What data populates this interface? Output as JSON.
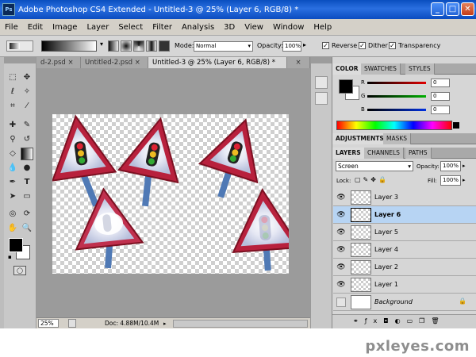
{
  "window": {
    "title": "Adobe Photoshop CS4 Extended - Untitled-3 @ 25% (Layer 6, RGB/8) *",
    "app_icon": "Ps",
    "minimize": "_",
    "maximize": "□",
    "close": "✕"
  },
  "menu": [
    "File",
    "Edit",
    "Image",
    "Layer",
    "Select",
    "Filter",
    "Analysis",
    "3D",
    "View",
    "Window",
    "Help"
  ],
  "options": {
    "mode_label": "Mode:",
    "mode_value": "Normal",
    "opacity_label": "Opacity:",
    "opacity_value": "100%",
    "reverse_label": "Reverse",
    "dither_label": "Dither",
    "transparency_label": "Transparency",
    "reverse_checked": true,
    "dither_checked": true,
    "transparency_checked": true
  },
  "tabs": [
    {
      "label": "d-2.psd ×",
      "active": false
    },
    {
      "label": "Untitled-2.psd ×",
      "active": false
    },
    {
      "label": "Untitled-3 @ 25% (Layer 6, RGB/8) *",
      "active": true
    },
    {
      "label": "×",
      "active": false
    }
  ],
  "status": {
    "zoom": "25%",
    "doc": "Doc: 4.88M/10.4M"
  },
  "color_panel": {
    "tabs": [
      "COLOR",
      "SWATCHES",
      "STYLES"
    ],
    "channels": [
      {
        "name": "R",
        "value": "0",
        "color": "#e00000"
      },
      {
        "name": "G",
        "value": "0",
        "color": "#00b000"
      },
      {
        "name": "B",
        "value": "0",
        "color": "#0030e0"
      }
    ],
    "foreground": "#000000",
    "background": "#ffffff"
  },
  "adjust_panel": {
    "tabs": [
      "ADJUSTMENTS",
      "MASKS"
    ]
  },
  "layers_panel": {
    "tabs": [
      "LAYERS",
      "CHANNELS",
      "PATHS"
    ],
    "blend_mode": "Screen",
    "opacity_label": "Opacity:",
    "opacity_value": "100%",
    "lock_label": "Lock:",
    "fill_label": "Fill:",
    "fill_value": "100%",
    "layers": [
      {
        "name": "Layer 3",
        "selected": false,
        "visible": true
      },
      {
        "name": "Layer 6",
        "selected": true,
        "visible": true
      },
      {
        "name": "Layer 5",
        "selected": false,
        "visible": true
      },
      {
        "name": "Layer 4",
        "selected": false,
        "visible": true
      },
      {
        "name": "Layer 2",
        "selected": false,
        "visible": true
      },
      {
        "name": "Layer 1",
        "selected": false,
        "visible": true
      },
      {
        "name": "Background",
        "selected": false,
        "visible": false
      }
    ]
  },
  "watermark": "pxleyes.com"
}
